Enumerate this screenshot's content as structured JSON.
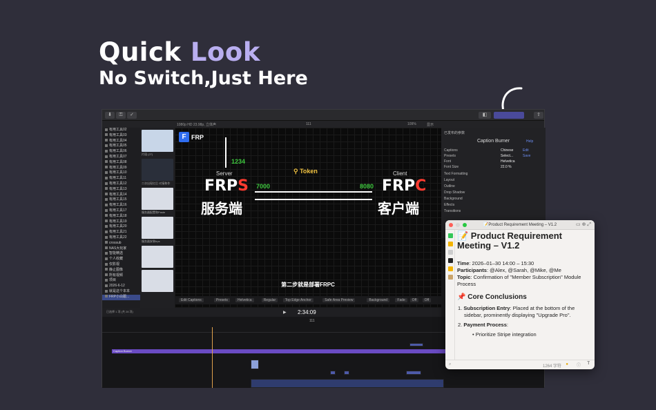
{
  "hero": {
    "title_part1": "Quick ",
    "title_part2": "Look",
    "subtitle": "No Switch,Just Here"
  },
  "colors": {
    "accent": "#b9aef0",
    "background": "#2f2e3a",
    "frp_red": "#ff3b30",
    "frp_green": "#3ec83e",
    "token_yellow": "#f4c542"
  },
  "editor": {
    "format": "1080p HD 23.98p, 立体声",
    "frame_count": "111",
    "zoom": "109%",
    "view": "显示",
    "timecode": "2:34:09",
    "timeline_index": "111",
    "sidebar_items": [
      "有用工具02",
      "有用工具03",
      "有用工具04",
      "有用工具05",
      "有用工具06",
      "有用工具07",
      "有用工具08",
      "有用工具09",
      "有用工具10",
      "有用工具11",
      "有用工具12",
      "有用工具13",
      "有用工具14",
      "有用工具15",
      "有用工具16",
      "有用工具17",
      "有用工具18",
      "有用工具19",
      "有用工具20",
      "有用工具21",
      "有用工具22",
      "crossub",
      "NAS大玩家",
      "智能精选",
      "个人收藏",
      "仅影视",
      "静止图像",
      "所有视频",
      "项目",
      "2026-6-12",
      "就是这个本本",
      "FRP小白跟..."
    ],
    "thumb_captions": [
      "片段 (27)",
      "二次出现红后·对接和作",
      "服务器配置和Paste",
      "服务器安装frps"
    ],
    "selection_info": "已选择 1 项 (共 28 项)",
    "viewer": {
      "logo": "FRP",
      "port_top": "1234",
      "server_label": "Server",
      "server_name_a": "FRP",
      "server_name_b": "S",
      "server_cn": "服务端",
      "token": "Token",
      "port_left": "7000",
      "port_right": "8080",
      "client_label": "Client",
      "client_name_a": "FRP",
      "client_name_b": "C",
      "client_cn": "客户端",
      "caption": "第二步就是部署FRPC"
    },
    "controls": [
      "Edit Captions",
      "Presets",
      "Helvetica",
      "Regular",
      "Top Edge Anchor",
      "Safe Area Preview",
      "Background",
      "Fade",
      "Off",
      "Off"
    ],
    "inspector": {
      "header": "已发布的参数",
      "title": "Caption Burner",
      "help": "Help",
      "rows": [
        {
          "label": "Captions",
          "value": "Chinese",
          "action": "Edit"
        },
        {
          "label": "Presets",
          "value": "Select...",
          "action": "Save"
        },
        {
          "label": "Font",
          "value": "Helvetica",
          "action": ""
        },
        {
          "label": "Font Size",
          "value": "22.0 %",
          "action": ""
        }
      ],
      "sections": [
        "Text Formatting",
        "Layout",
        "Outline",
        "Drop Shadow",
        "Background",
        "Effects",
        "Transitions"
      ]
    },
    "timeline_clip_label": "Caption Burner"
  },
  "quicklook": {
    "window_title": "📝Product Requirement Meeting – V1.2",
    "heading": "📝 Product Requirement Meeting – V1.2",
    "time_label": "Time",
    "time_value": ": 2026–01–30 14:00 – 15:30",
    "participants_label": "Participants",
    "participants_value": ": @Alex, @Sarah, @Mike, @Me",
    "topic_label": "Topic",
    "topic_value": ": Confirmation of \"Member Subscription\" Module Process",
    "section_heading": "📌 Core Conclusions",
    "item1_label": "Subscription Entry",
    "item1_value": ": Placed at the bottom of the sidebar, prominently displaying \"Upgrade Pro\".",
    "item2_label": "Payment Process",
    "item2_value": ":",
    "bullet1": "Prioritize Stripe integration",
    "char_count": "1264 字符",
    "footer_t": "T"
  }
}
